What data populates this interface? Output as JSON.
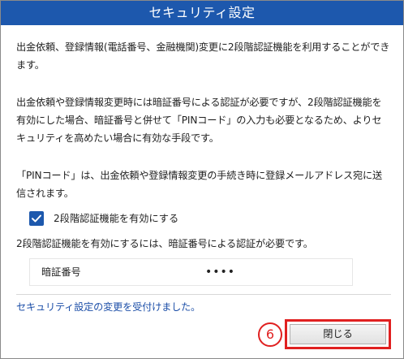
{
  "window": {
    "title": "セキュリティ設定"
  },
  "content": {
    "paragraph_1": "出金依頼、登録情報(電話番号、金融機関)変更に2段階認証機能を利用することができます。",
    "paragraph_2": "出金依頼や登録情報変更時には暗証番号による認証が必要ですが、2段階認証機能を有効にした場合、暗証番号と併せて「PINコード」の入力も必要となるため、よりセキュリティを高めたい場合に有効な手段です。",
    "paragraph_3": "「PINコード」は、出金依頼や登録情報変更の手続き時に登録メールアドレス宛に送信されます。"
  },
  "checkbox": {
    "label": "2段階認証機能を有効にする",
    "checked": true
  },
  "requirement_text": "2段階認証機能を有効にするには、暗証番号による認証が必要です。",
  "pin_field": {
    "label": "暗証番号",
    "value": "••••"
  },
  "notice": "セキュリティ設定の変更を受付けました。",
  "footer": {
    "step_number": "6",
    "close_label": "閉じる"
  },
  "colors": {
    "titlebar": "#1d58ad",
    "accent": "#1d58ad",
    "notice_text": "#1d4fa8",
    "highlight": "#e02020"
  },
  "icons": {
    "checkbox": "check-icon"
  }
}
